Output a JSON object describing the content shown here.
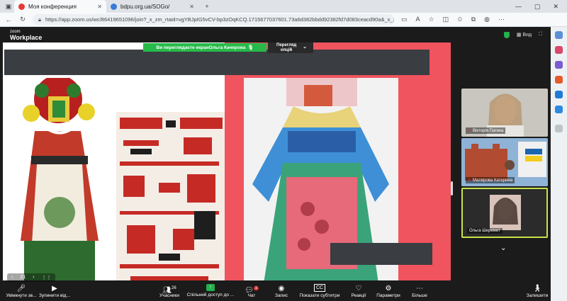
{
  "browser": {
    "tabs": [
      {
        "title": "Моя конференция",
        "active": true,
        "favicon_color": "#e53935"
      },
      {
        "title": "bdpu.org.ua/SOGo/",
        "active": false,
        "favicon_color": "#3a7bd5"
      }
    ],
    "url": "https://app.zoom.us/wc/86419651096/join?_x_zm_rtaid=vgYBJpIG5vCV-bp3zOqKCQ.1715677037601.73a6d382bbdd92382fd7d083ceacd90a&_x_z..."
  },
  "zoom": {
    "logo_top": "zoom",
    "logo_bottom": "Workplace",
    "view_label": "Вид",
    "banner": "Ви переглядаєте екранОльга Качерова",
    "view_options": "Перегляд опцій",
    "page_number": "21",
    "participants": [
      {
        "name": "Вікторія Патика",
        "muted": true
      },
      {
        "name": "Малярова Катерина",
        "muted": true
      },
      {
        "name": "Ольга Шеремет",
        "muted": false
      }
    ],
    "toolbar": {
      "mic": "Увімкнути зв...",
      "video": "Зупинити від...",
      "participants": "Учасники",
      "participants_count": "26",
      "share": "Спільний доступ до ...",
      "chat": "Чат",
      "chat_badge": "1",
      "record": "Запис",
      "captions": "Показати субтитри",
      "reactions": "Реакції",
      "settings": "Параметри",
      "more": "Більше",
      "leave": "Залишити"
    }
  },
  "colors": {
    "zoom_green": "#22b14c",
    "active_tile": "#c7e34a",
    "slide_pink": "#f0545e"
  }
}
